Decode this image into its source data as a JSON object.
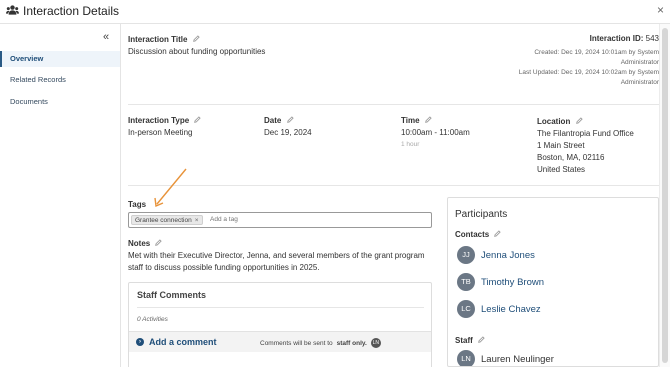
{
  "header": {
    "title": "Interaction Details",
    "close_label": "×"
  },
  "sidebar": {
    "collapse_label": "«",
    "items": [
      {
        "label": "Overview",
        "active": true
      },
      {
        "label": "Related Records",
        "active": false
      },
      {
        "label": "Documents",
        "active": false
      }
    ]
  },
  "interaction": {
    "title_label": "Interaction Title",
    "title_value": "Discussion about funding opportunities",
    "id_label": "Interaction ID:",
    "id_value": "543",
    "created": "Created: Dec 19, 2024 10:01am by System",
    "created_by": "Administrator",
    "updated": "Last Updated: Dec 19, 2024 10:02am by System",
    "updated_by": "Administrator"
  },
  "details": {
    "type_label": "Interaction Type",
    "type_value": "In-person Meeting",
    "date_label": "Date",
    "date_value": "Dec 19, 2024",
    "time_label": "Time",
    "time_value": "10:00am - 11:00am",
    "duration": "1 hour",
    "location_label": "Location",
    "location_line1": "The Filantropia Fund Office",
    "location_line2": "1 Main Street",
    "location_line3": "Boston, MA, 02116",
    "location_line4": "United States"
  },
  "tags": {
    "label": "Tags",
    "items": [
      "Grantee connection"
    ],
    "remove_label": "×",
    "placeholder": "Add a tag"
  },
  "notes": {
    "label": "Notes",
    "text": "Met with their Executive Director, Jenna, and several members of the grant program staff to discuss possible funding opportunities in 2025."
  },
  "staff_comments": {
    "title": "Staff Comments",
    "activities": "0 Activities",
    "add_label": "Add a comment",
    "note_prefix": "Comments will be sent to",
    "note_bold": "staff only.",
    "badge": "LN"
  },
  "participants": {
    "title": "Participants",
    "contacts_label": "Contacts",
    "contacts": [
      {
        "initials": "JJ",
        "name": "Jenna Jones"
      },
      {
        "initials": "TB",
        "name": "Timothy Brown"
      },
      {
        "initials": "LC",
        "name": "Leslie Chavez"
      }
    ],
    "staff_label": "Staff",
    "staff": [
      {
        "initials": "LN",
        "name": "Lauren Neulinger"
      }
    ]
  },
  "colors": {
    "accent": "#1f4e79",
    "annotation_arrow": "#e8933a",
    "avatar": "#6b7785"
  }
}
